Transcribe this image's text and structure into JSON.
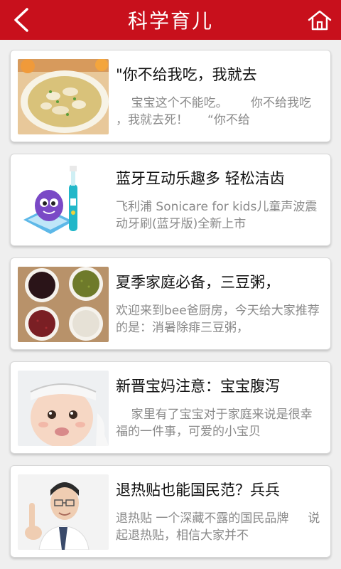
{
  "header": {
    "title": "科学育儿",
    "back_icon": "back-arrow-icon",
    "home_icon": "home-icon",
    "bg_color": "#c8101c"
  },
  "articles": [
    {
      "title": "\"你不给我吃，我就去",
      "desc": "    宝宝这个不能吃。      你不给我吃 ，我就去死！     “你不给",
      "image": "dumpling-soup-image"
    },
    {
      "title": "蓝牙互动乐趣多 轻松洁齿",
      "desc": "飞利浦 Sonicare for kids儿童声波震动牙刷(蓝牙版)全新上市",
      "image": "kids-toothbrush-image"
    },
    {
      "title": "夏季家庭必备，三豆粥，",
      "desc": "欢迎来到bee爸厨房，今天给大家推荐的是：消暑除痱三豆粥，",
      "image": "beans-bowls-image"
    },
    {
      "title": "新晋宝妈注意：宝宝腹泻",
      "desc": "    家里有了宝宝对于家庭来说是很幸福的一件事，可爱的小宝贝",
      "image": "baby-portrait-image"
    },
    {
      "title": "退热贴也能国民范？兵兵",
      "desc": "退热贴 一个深藏不露的国民品牌     说起退热贴，相信大家并不",
      "image": "doctor-image"
    }
  ]
}
